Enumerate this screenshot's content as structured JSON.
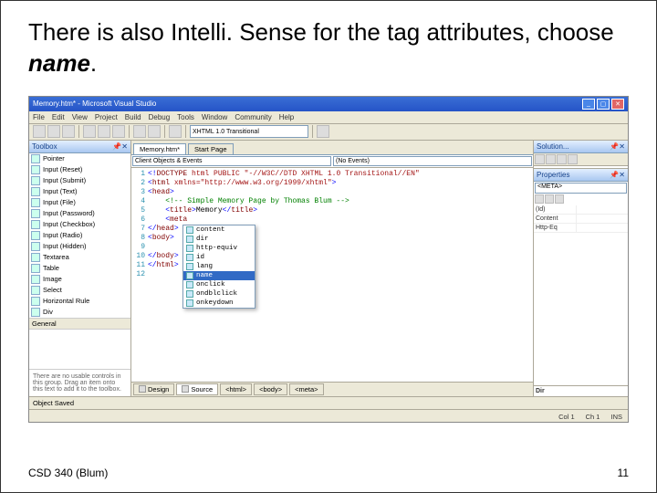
{
  "slide": {
    "title_prefix": "There ",
    "title_main": "is also Intelli. Sense for the tag attributes, choose ",
    "title_emph": "name",
    "title_suffix": ".",
    "footer_left": "CSD 340 (Blum)",
    "footer_right": "11"
  },
  "vs": {
    "title": "Memory.htm* - Microsoft Visual Studio",
    "menu": [
      "File",
      "Edit",
      "View",
      "Project",
      "Build",
      "Debug",
      "Tools",
      "Window",
      "Community",
      "Help"
    ],
    "doctype_dropdown": "XHTML 1.0 Transitional",
    "tab_label": "Memory.htm*",
    "start_page": "Start Page",
    "dropdown_left": "Client Objects & Events",
    "dropdown_right": "(No Events)",
    "statusbar_left": "Object Saved",
    "statusbar_col": "Col 1",
    "statusbar_ch": "Ch 1",
    "statusbar_ins": "INS",
    "bottom_tabs": [
      "Design",
      "Source",
      "<html>",
      "<body>",
      "<meta>"
    ]
  },
  "toolbox": {
    "header": "Toolbox",
    "items": [
      "Pointer",
      "Input (Reset)",
      "Input (Submit)",
      "Input (Text)",
      "Input (File)",
      "Input (Password)",
      "Input (Checkbox)",
      "Input (Radio)",
      "Input (Hidden)",
      "Textarea",
      "Table",
      "Image",
      "Select",
      "Horizontal Rule",
      "Div"
    ],
    "section": "General",
    "msg": "There are no usable controls in this group. Drag an item onto this text to add it to the toolbox."
  },
  "code": {
    "lines": [
      "<!DOCTYPE html PUBLIC \"-//W3C//DTD XHTML 1.0 Transitional//EN\" ",
      "<html xmlns=\"http://www.w3.org/1999/xhtml\">",
      "<head>",
      "    <!-- Simple Memory Page by Thomas Blum -->",
      "    <title>Memory</title>",
      "    <meta ",
      "</head>",
      "<body>",
      "",
      "</body>",
      "</html>",
      ""
    ]
  },
  "intellisense": {
    "items": [
      "content",
      "dir",
      "http-equiv",
      "id",
      "lang",
      "name",
      "onclick",
      "ondblclick",
      "onkeydown"
    ],
    "selected": "name"
  },
  "solution": {
    "header": "Solution...",
    "item": ""
  },
  "properties": {
    "header": "Properties",
    "selected": "<META>",
    "rows": [
      {
        "k": "(Id)",
        "v": ""
      },
      {
        "k": "Content",
        "v": ""
      },
      {
        "k": "Http-Eq",
        "v": ""
      }
    ],
    "desc_label": "Dir"
  }
}
